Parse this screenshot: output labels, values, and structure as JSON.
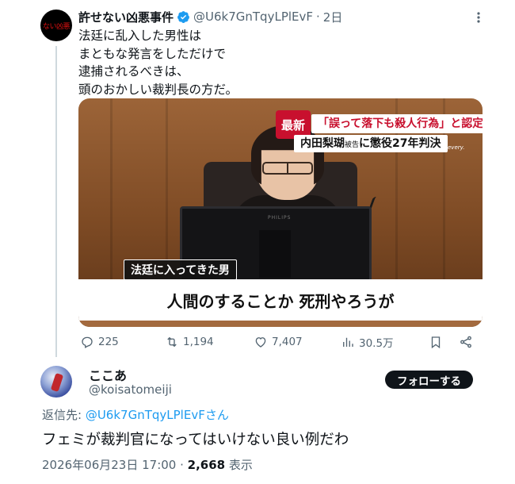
{
  "original_tweet": {
    "avatar_text": "ない凶悪",
    "display_name": "許せない凶悪事件",
    "handle": "@U6k7GnTqyLPlEvF",
    "separator": "·",
    "time": "2日",
    "text": "法廷に乱入した男性は\nまともな発言をしただけで\n逮捕されるべきは、\n頭のおかしい裁判長の方だ。",
    "media": {
      "news_badge": "最新",
      "headline_line1": "「誤って落下も殺人行為」と認定",
      "headline_line2_name": "内田梨瑚",
      "headline_line2_suffix": "被告",
      "headline_line2_rest": "に懲役27年判決",
      "channel_logo": "every.",
      "monitor_brand": "PHILIPS",
      "speaker_label": "法廷に入ってきた男",
      "caption": "人間のすることか 死刑やろうが"
    },
    "stats": {
      "replies": "225",
      "retweets": "1,194",
      "likes": "7,407",
      "views": "30.5万"
    }
  },
  "reply_tweet": {
    "display_name": "ここあ",
    "handle": "@koisatomeiji",
    "follow_label": "フォローする",
    "reply_to_prefix": "返信先: ",
    "reply_to_mention": "@U6k7GnTqyLPlEvFさん",
    "text": "フェミが裁判官になってはいけない良い例だわ",
    "timestamp": "2026年06月23日 17:00 · ",
    "view_count": "2,668",
    "view_label": " 表示"
  },
  "colors": {
    "verified_blue": "#1d9bf0",
    "muted_text": "#536471",
    "news_red": "#c8102e"
  }
}
